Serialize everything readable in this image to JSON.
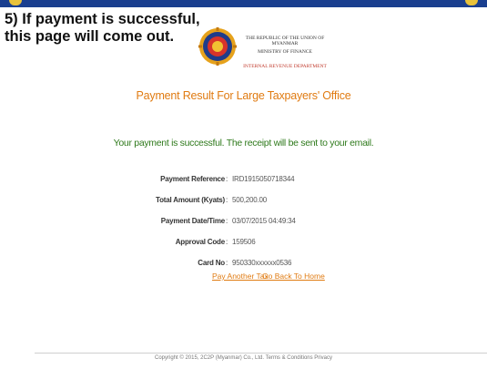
{
  "callout": {
    "line1": "5) If payment is successful,",
    "line2": "this page will come out."
  },
  "header": {
    "ministry_line1": "THE REPUBLIC OF THE UNION OF MYANMAR",
    "ministry_line2": "MINISTRY OF FINANCE",
    "ministry_line3": "INTERNAL REVENUE DEPARTMENT",
    "logo_icon": "ministry-seal-icon"
  },
  "page": {
    "title": "Payment Result For Large Taxpayers' Office",
    "success_message": "Your payment is successful. The receipt will be sent to your email."
  },
  "details": [
    {
      "label": "Payment Reference",
      "value": "IRD1915050718344"
    },
    {
      "label": "Total Amount (Kyats)",
      "value": "500,200.00"
    },
    {
      "label": "Payment Date/Time",
      "value": "03/07/2015 04:49:34"
    },
    {
      "label": "Approval Code",
      "value": "159506"
    },
    {
      "label": "Card No",
      "value": "950330xxxxxx0536"
    }
  ],
  "links": {
    "pay_another": "Pay Another Tax",
    "go_home": "Go Back To Home"
  },
  "footer": {
    "copyright": "Copyright © 2015, 2C2P (Myanmar) Co., Ltd. Terms & Conditions Privacy"
  },
  "colors": {
    "frame": "#1a3f8f",
    "accent_orange": "#e07b12",
    "success_green": "#2f7a1c"
  }
}
